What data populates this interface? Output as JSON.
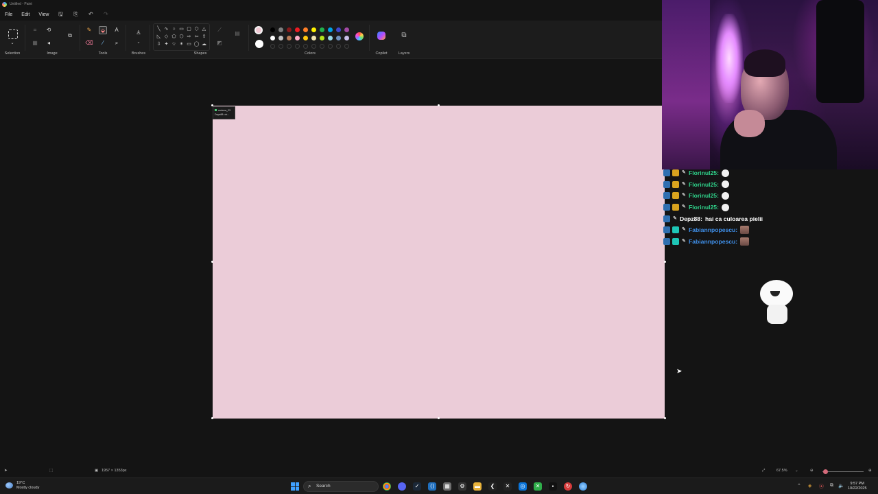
{
  "window": {
    "title": "Untitled - Paint"
  },
  "menu": {
    "file": "File",
    "edit": "Edit",
    "view": "View"
  },
  "ribbon": {
    "groups": {
      "selection": "Selection",
      "image": "Image",
      "tools": "Tools",
      "brushes": "Brushes",
      "shapes": "Shapes",
      "colors": "Colors",
      "copilot": "Copilot",
      "layers": "Layers"
    },
    "primary_color": "#f2c9d4",
    "secondary_color": "#ffffff",
    "palette": [
      "#000000",
      "#7f7f7f",
      "#881a1b",
      "#ed1c24",
      "#ff7f27",
      "#fff200",
      "#22b14c",
      "#00a2e8",
      "#3f48cc",
      "#a349a4",
      "#ffffff",
      "#c3c3c3",
      "#b97a57",
      "#ffaec9",
      "#ffc90e",
      "#efe4b0",
      "#b5e61d",
      "#99d9ea",
      "#7092be",
      "#c8bfe7"
    ]
  },
  "canvas": {
    "color": "#ebccd8",
    "tooltip": {
      "user": "norieea_23",
      "line": "Depz88: ok..."
    }
  },
  "chat": {
    "messages": [
      {
        "user": "Florinul25:",
        "text": "",
        "color": "#2fd28a",
        "badges": [
          "mod",
          "sub"
        ],
        "emote": "white"
      },
      {
        "user": "Florinul25:",
        "text": "",
        "color": "#2fd28a",
        "badges": [
          "mod",
          "sub"
        ],
        "emote": "white"
      },
      {
        "user": "Florinul25:",
        "text": "",
        "color": "#2fd28a",
        "badges": [
          "mod",
          "sub"
        ],
        "emote": "white"
      },
      {
        "user": "Florinul25:",
        "text": "",
        "color": "#2fd28a",
        "badges": [
          "mod",
          "sub"
        ],
        "emote": "white"
      },
      {
        "user": "Depz88:",
        "text": "hai ca culoarea pielii",
        "color": "#ffffff",
        "badges": [
          "mod"
        ],
        "emote": ""
      },
      {
        "user": "Fabiannpopescu:",
        "text": "",
        "color": "#3f8fe8",
        "badges": [
          "mod",
          "vip"
        ],
        "emote": "pic"
      },
      {
        "user": "Fabiannpopescu:",
        "text": "",
        "color": "#3f8fe8",
        "badges": [
          "mod",
          "vip"
        ],
        "emote": "pic"
      }
    ]
  },
  "status": {
    "canvas_size": "1957 × 1353px",
    "zoom": "67.5%"
  },
  "taskbar": {
    "weather_temp": "19°C",
    "weather_desc": "Mostly cloudy",
    "search_label": "Search",
    "time": "9:57 PM",
    "date": "10/22/2025"
  }
}
